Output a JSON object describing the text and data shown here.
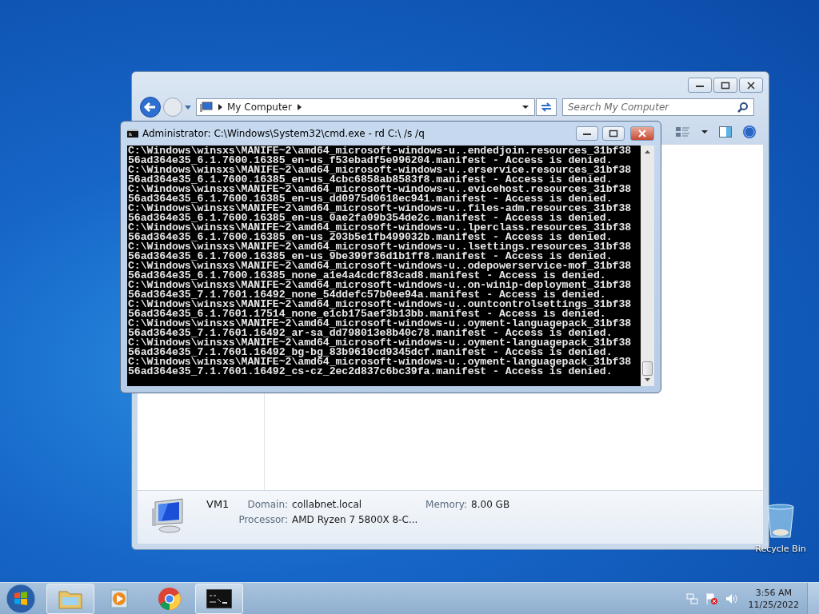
{
  "explorer": {
    "address": "My Computer",
    "search": {
      "placeholder": "Search My Computer"
    },
    "details": {
      "name": "VM1",
      "fields": [
        {
          "label": "Domain:",
          "value": "collabnet.local"
        },
        {
          "label": "Memory:",
          "value": "8.00 GB"
        },
        {
          "label": "Processor:",
          "value": "AMD Ryzen 7 5800X 8-C..."
        }
      ]
    }
  },
  "console": {
    "title": "Administrator: C:\\Windows\\System32\\cmd.exe - rd  C:\\ /s /q",
    "lines": [
      "C:\\Windows\\winsxs\\MANIFE~2\\amd64_microsoft-windows-u..endedjoin.resources_31bf38",
      "56ad364e35_6.1.7600.16385_en-us_f53ebadf5e996204.manifest - Access is denied.",
      "C:\\Windows\\winsxs\\MANIFE~2\\amd64_microsoft-windows-u..erservice.resources_31bf38",
      "56ad364e35_6.1.7600.16385_en-us_4cbc6858ab8583f8.manifest - Access is denied.",
      "C:\\Windows\\winsxs\\MANIFE~2\\amd64_microsoft-windows-u..evicehost.resources_31bf38",
      "56ad364e35_6.1.7600.16385_en-us_dd0975d0618ec941.manifest - Access is denied.",
      "C:\\Windows\\winsxs\\MANIFE~2\\amd64_microsoft-windows-u..files-adm.resources_31bf38",
      "56ad364e35_6.1.7600.16385_en-us_0ae2fa09b354de2c.manifest - Access is denied.",
      "C:\\Windows\\winsxs\\MANIFE~2\\amd64_microsoft-windows-u..lperclass.resources_31bf38",
      "56ad364e35_6.1.7600.16385_en-us_203b5e1fb499032b.manifest - Access is denied.",
      "C:\\Windows\\winsxs\\MANIFE~2\\amd64_microsoft-windows-u..lsettings.resources_31bf38",
      "56ad364e35_6.1.7600.16385_en-us_9be399f36d1b1ff8.manifest - Access is denied.",
      "C:\\Windows\\winsxs\\MANIFE~2\\amd64_microsoft-windows-u..odepowerservice-mof_31bf38",
      "56ad364e35_6.1.7600.16385_none_a1e4a4cdcf83cad8.manifest - Access is denied.",
      "C:\\Windows\\winsxs\\MANIFE~2\\amd64_microsoft-windows-u..on-winip-deployment_31bf38",
      "56ad364e35_7.1.7601.16492_none_54ddefc57b0ee94a.manifest - Access is denied.",
      "C:\\Windows\\winsxs\\MANIFE~2\\amd64_microsoft-windows-u..ountcontrolsettings_31bf38",
      "56ad364e35_6.1.7601.17514_none_e1cb175aef3b13bb.manifest - Access is denied.",
      "C:\\Windows\\winsxs\\MANIFE~2\\amd64_microsoft-windows-u..oyment-languagepack_31bf38",
      "56ad364e35_7.1.7601.16492_ar-sa_dd798013e8b40c78.manifest - Access is denied.",
      "C:\\Windows\\winsxs\\MANIFE~2\\amd64_microsoft-windows-u..oyment-languagepack_31bf38",
      "56ad364e35_7.1.7601.16492_bg-bg_83b9619cd9345dcf.manifest - Access is denied.",
      "C:\\Windows\\winsxs\\MANIFE~2\\amd64_microsoft-windows-u..oyment-languagepack_31bf38",
      "56ad364e35_7.1.7601.16492_cs-cz_2ec2d837c6bc39fa.manifest - Access is denied."
    ]
  },
  "desktop_icons": [
    {
      "label": "Recycle Bin"
    }
  ],
  "taskbar": {
    "items": [
      {
        "kind": "folder",
        "running": true
      },
      {
        "kind": "media",
        "running": false
      },
      {
        "kind": "browser",
        "running": false
      },
      {
        "kind": "console",
        "running": true
      }
    ],
    "clock": {
      "time": "3:56 AM",
      "date": "11/25/2022"
    }
  }
}
